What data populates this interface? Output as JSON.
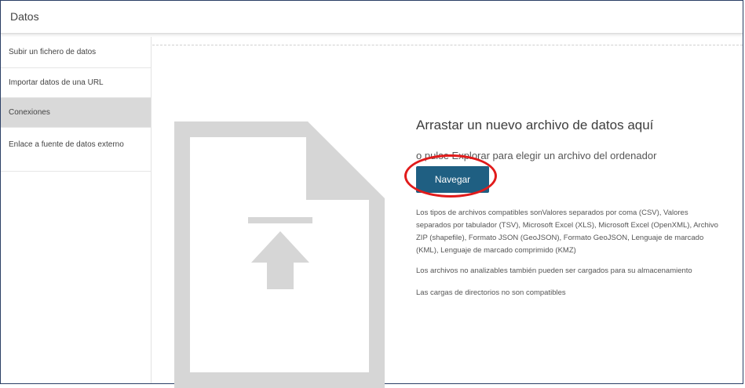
{
  "header": {
    "title": "Datos"
  },
  "sidebar": {
    "items": [
      {
        "label": "Subir un fichero de datos"
      },
      {
        "label": "Importar datos de una URL"
      },
      {
        "label": "Conexiones",
        "selected": true
      },
      {
        "label": "Enlace a fuente de datos externo"
      }
    ]
  },
  "dropzone": {
    "icon": "file-upload-icon",
    "title": "Arrastar un nuevo archivo de datos aquí",
    "subtitle": "o pulse Explorar para elegir un archivo del ordenador",
    "browse_label": "Navegar",
    "supported_types": "Los tipos de archivos compatibles sonValores separados por coma (CSV), Valores separados por tabulador (TSV), Microsoft Excel (XLS), Microsoft Excel (OpenXML), Archivo ZIP (shapefile), Formato JSON (GeoJSON), Formato GeoJSON, Lenguaje de marcado (KML), Lenguaje de marcado comprimido (KMZ)",
    "non_parsable_note": "Los archivos no analizables también pueden ser cargados para su almacenamiento",
    "directories_note": "Las cargas de directorios no son compatibles"
  },
  "colors": {
    "accent": "#1f5f82",
    "selected_item": "#d9d9d9",
    "highlight_ring": "#e11b1b",
    "icon": "#d6d6d6"
  }
}
